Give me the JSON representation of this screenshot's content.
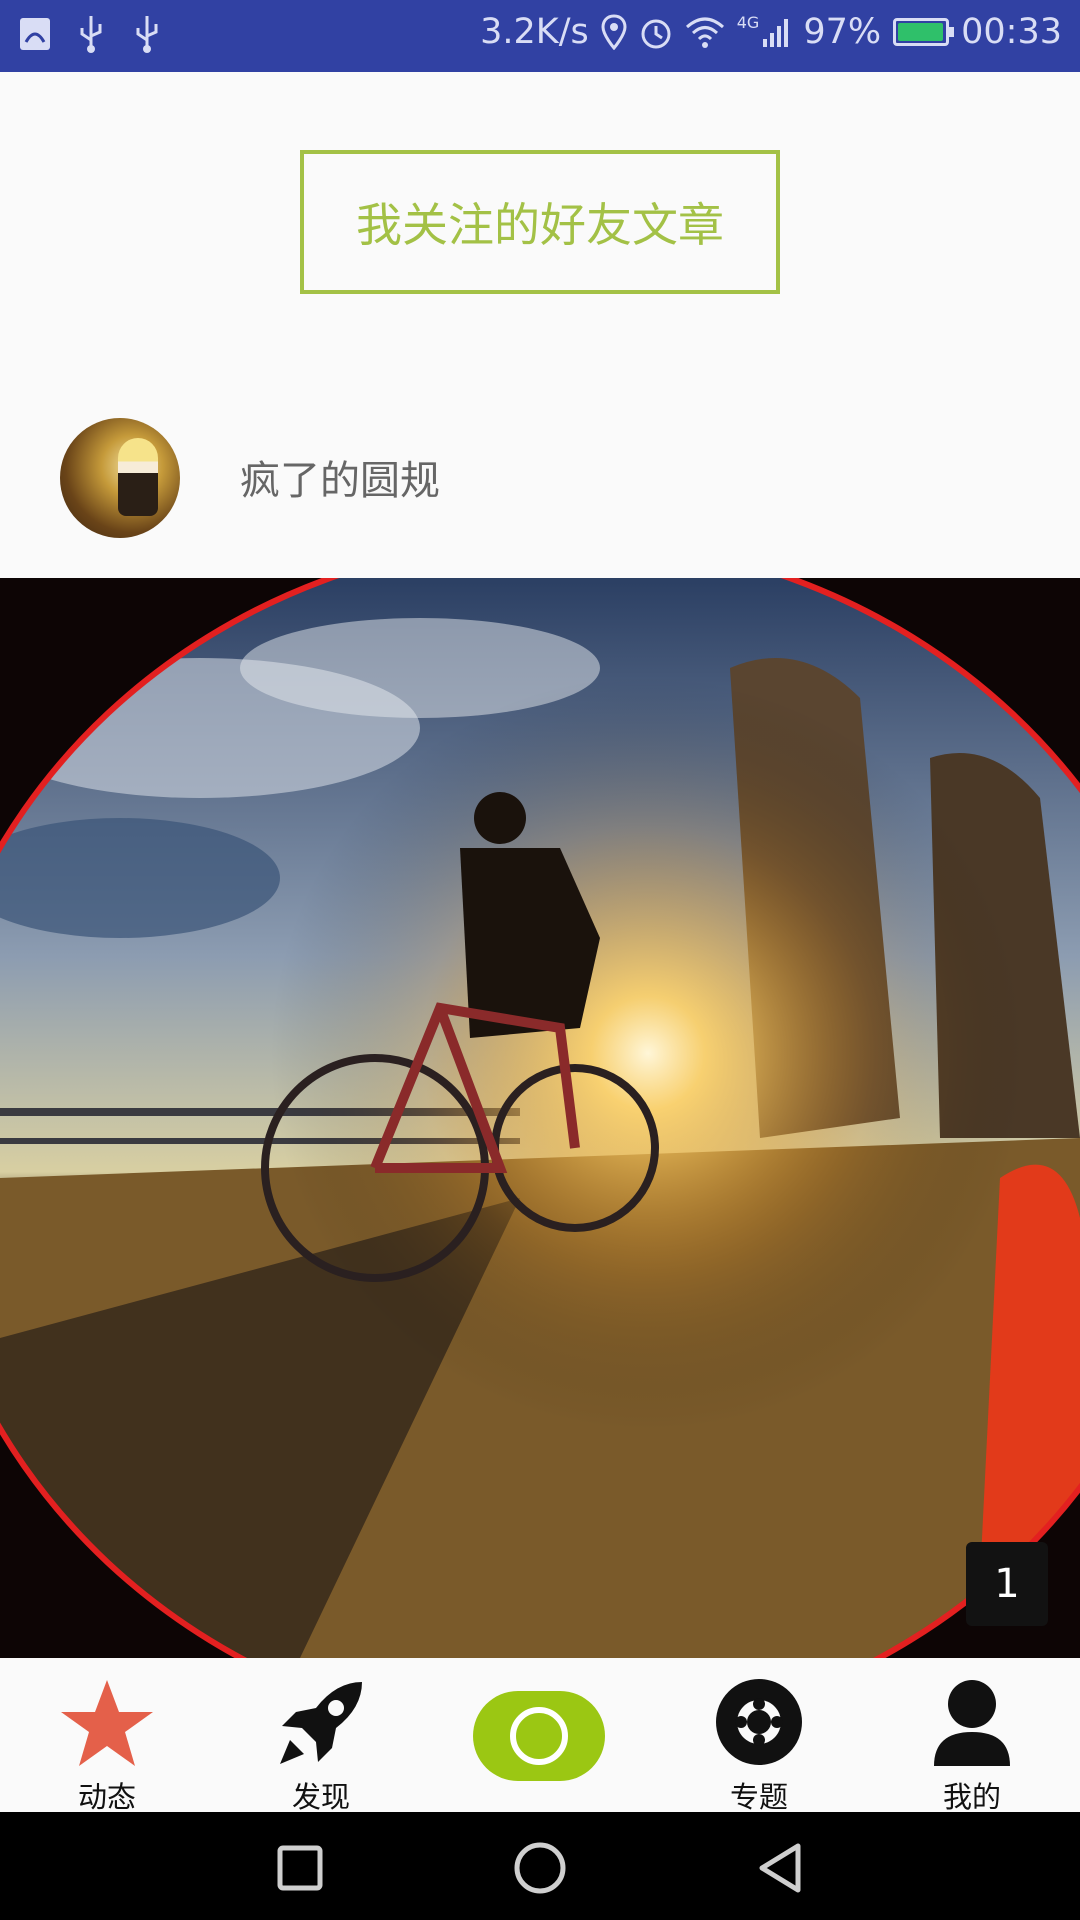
{
  "status_bar": {
    "net_speed": "3.2K/s",
    "network": "4G",
    "battery": "97%",
    "time": "00:33",
    "colors": {
      "background": "#3141a3",
      "battery_fill": "#2fc06a"
    },
    "icons": [
      "app-notification-icon",
      "usb-icon",
      "usb-icon",
      "location-icon",
      "alarm-icon",
      "wifi-icon",
      "signal-icon",
      "battery-icon"
    ]
  },
  "header": {
    "title": "我关注的好友文章",
    "accent_color": "#a3c146"
  },
  "post": {
    "author_name": "疯了的圆规",
    "image_index": "1",
    "image_level": 0.97
  },
  "tabbar": {
    "accent_color": "#9bc713",
    "tabs": [
      {
        "label": "动态",
        "icon": "star-icon",
        "active": true
      },
      {
        "label": "发现",
        "icon": "rocket-icon"
      },
      {
        "label": "",
        "icon": "camera-icon"
      },
      {
        "label": "专题",
        "icon": "film-reel-icon"
      },
      {
        "label": "我的",
        "icon": "person-icon"
      }
    ]
  },
  "navbar": {
    "icons": [
      "recent-apps-icon",
      "home-icon",
      "back-icon"
    ]
  }
}
